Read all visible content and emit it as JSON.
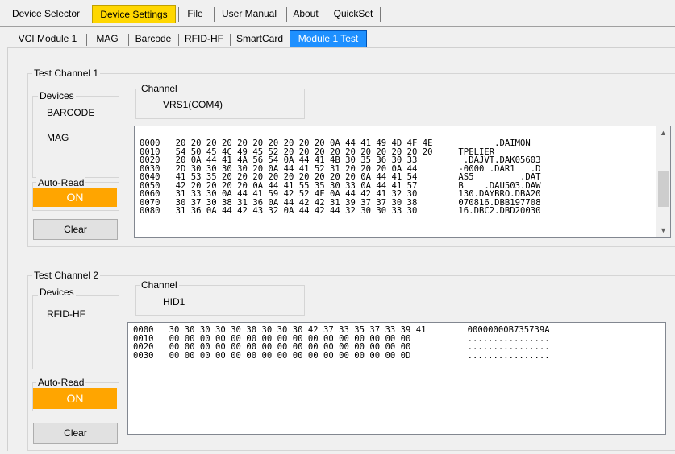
{
  "top_tabs": [
    "Device Selector",
    "Device Settings",
    "File",
    "User Manual",
    "About",
    "QuickSet"
  ],
  "sub_tabs": [
    "VCI Module 1",
    "MAG",
    "Barcode",
    "RFID-HF",
    "SmartCard",
    "Module 1 Test"
  ],
  "channel1": {
    "group_title": "Test Channel 1",
    "devices_label": "Devices",
    "devices": [
      "BARCODE",
      "MAG"
    ],
    "channel_label": "Channel",
    "channel_value": "VRS1(COM4)",
    "autoread_label": "Auto-Read",
    "autoread_value": "ON",
    "clear_label": "Clear",
    "hex_lines": [
      "0000   20 20 20 20 20 20 20 20 20 20 0A 44 41 49 4D 4F 4E            .DAIMON",
      "0010   54 50 45 4C 49 45 52 20 20 20 20 20 20 20 20 20 20     TPELIER",
      "0020   20 0A 44 41 4A 56 54 0A 44 41 4B 30 35 36 30 33         .DAJVT.DAK05603",
      "0030   2D 30 30 30 30 20 0A 44 41 52 31 20 20 20 0A 44        -0000 .DAR1   .D",
      "0040   41 53 35 20 20 20 20 20 20 20 20 20 0A 44 41 54        AS5         .DAT",
      "0050   42 20 20 20 20 0A 44 41 55 35 30 33 0A 44 41 57        B    .DAU503.DAW",
      "0060   31 33 30 0A 44 41 59 42 52 4F 0A 44 42 41 32 30        130.DAYBRO.DBA20",
      "0070   30 37 30 38 31 36 0A 44 42 42 31 39 37 37 30 38        070816.DBB197708",
      "0080   31 36 0A 44 42 43 32 0A 44 42 44 32 30 30 33 30        16.DBC2.DBD20030"
    ]
  },
  "channel2": {
    "group_title": "Test Channel 2",
    "devices_label": "Devices",
    "devices": [
      "RFID-HF"
    ],
    "channel_label": "Channel",
    "channel_value": "HID1",
    "autoread_label": "Auto-Read",
    "autoread_value": "ON",
    "clear_label": "Clear",
    "hex_lines": [
      "0000   30 30 30 30 30 30 30 30 30 42 37 33 35 37 33 39 41        00000000B735739A",
      "0010   00 00 00 00 00 00 00 00 00 00 00 00 00 00 00 00           ................",
      "0020   00 00 00 00 00 00 00 00 00 00 00 00 00 00 00 00           ................",
      "0030   00 00 00 00 00 00 00 00 00 00 00 00 00 00 00 0D           ................"
    ]
  },
  "icons": {
    "scroll_up": "▲",
    "scroll_down": "▼"
  },
  "colors": {
    "active_top_tab": "#ffd700",
    "active_sub_tab": "#1e90ff",
    "autoread_on": "#ffa500"
  }
}
